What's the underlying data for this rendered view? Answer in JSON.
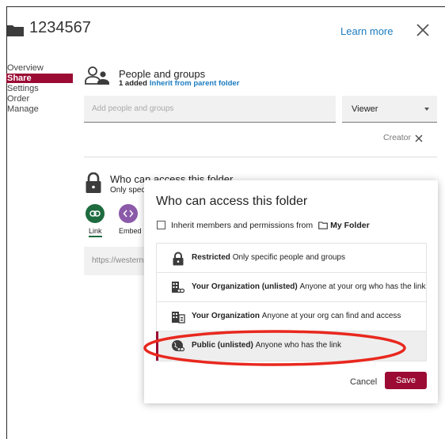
{
  "header": {
    "title": "1234567",
    "learn_more": "Learn more"
  },
  "nav": {
    "items": [
      {
        "label": "Overview",
        "active": false
      },
      {
        "label": "Share",
        "active": true
      },
      {
        "label": "Settings",
        "active": false
      },
      {
        "label": "Order",
        "active": false
      },
      {
        "label": "Manage",
        "active": false
      }
    ]
  },
  "people": {
    "title": "People and groups",
    "added_count": "1 added",
    "inherit_link": "Inherit from parent folder",
    "input_placeholder": "Add people and groups",
    "role": "Viewer",
    "creator_label": "Creator"
  },
  "access_section": {
    "title": "Who can access this folder",
    "subtitle": "Only specific people and groups",
    "options": [
      {
        "label": "Link",
        "icon": "link-icon"
      },
      {
        "label": "Embed",
        "icon": "embed-icon"
      }
    ],
    "url": "https://westerns"
  },
  "popup": {
    "title": "Who can access this folder",
    "inherit_text": "Inherit members and permissions from",
    "inherit_folder": "My Folder",
    "options": [
      {
        "name": "Restricted",
        "desc": "Only specific people and groups",
        "icon": "lock-icon",
        "selected": false
      },
      {
        "name": "Your Organization (unlisted)",
        "desc": "Anyone at your org who has the link",
        "icon": "org-link-icon",
        "selected": false
      },
      {
        "name": "Your Organization",
        "desc": "Anyone at your org can find and access",
        "icon": "org-icon",
        "selected": false
      },
      {
        "name": "Public (unlisted)",
        "desc": "Anyone who has the link",
        "icon": "globe-link-icon",
        "selected": true
      }
    ],
    "cancel_label": "Cancel",
    "save_label": "Save"
  },
  "colors": {
    "brand": "#9b0b33",
    "link": "#1a7bbf",
    "link_option": "#1d6b3e",
    "embed_option": "#8b5aa8",
    "annotation": "#e8281e"
  }
}
